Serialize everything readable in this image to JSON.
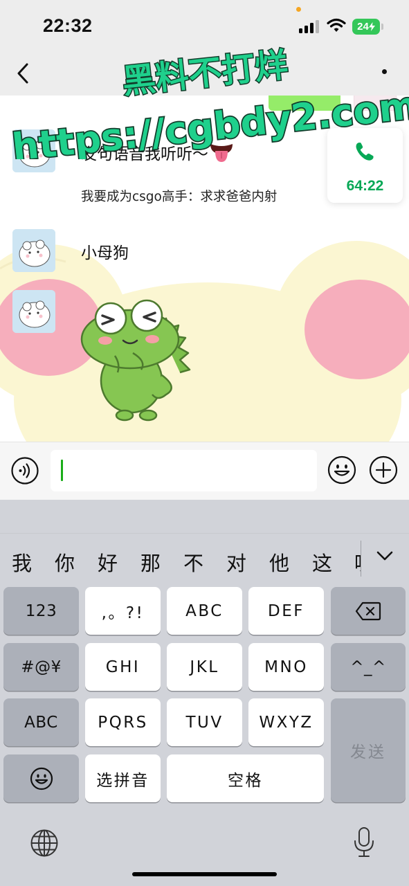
{
  "status_bar": {
    "time": "22:32",
    "battery_level": "24",
    "signal_bars_active": 3,
    "icons": [
      "signal-icon",
      "wifi-icon",
      "battery-charging-icon"
    ],
    "colors": {
      "battery": "#34c759",
      "dot": "#f5a623"
    }
  },
  "nav": {
    "back_icon": "chevron-left-icon",
    "more_icon": "more-icon"
  },
  "watermark": {
    "line1": "黑料不打烊",
    "line2": "https://cgbdy2.com",
    "colors": {
      "fill": "#1fd08c",
      "outline": "#123b2a"
    }
  },
  "messages": [
    {
      "type": "text",
      "text": "发句语音我听听～",
      "emoji": "tongue-emoji"
    },
    {
      "type": "quote",
      "text": "我要成为csgo高手：求求爸爸内射"
    },
    {
      "type": "text",
      "text": "小母狗"
    },
    {
      "type": "sticker",
      "sticker": "frog-sticker"
    }
  ],
  "call": {
    "icon": "phone-icon",
    "timer": "64:22",
    "color": "#07a856"
  },
  "input_bar": {
    "value": "",
    "icons": [
      "voice-icon",
      "emoji-icon",
      "plus-icon"
    ],
    "caret_color": "#1aad19"
  },
  "keyboard": {
    "candidates": [
      "我",
      "你",
      "好",
      "那",
      "不",
      "对",
      "他",
      "这",
      "呢"
    ],
    "rows": {
      "row1": [
        "123",
        ",。?!",
        "ABC",
        "DEF"
      ],
      "row2": [
        "#@¥",
        "GHI",
        "JKL",
        "MNO",
        "^_^"
      ],
      "row3": [
        "ABC",
        "PQRS",
        "TUV",
        "WXYZ"
      ],
      "row4": [
        "选拼音",
        "空格"
      ]
    },
    "send_label": "发送",
    "icons": [
      "delete-icon",
      "smiley-key-icon",
      "globe-icon",
      "microphone-icon",
      "chevron-down-icon"
    ]
  }
}
